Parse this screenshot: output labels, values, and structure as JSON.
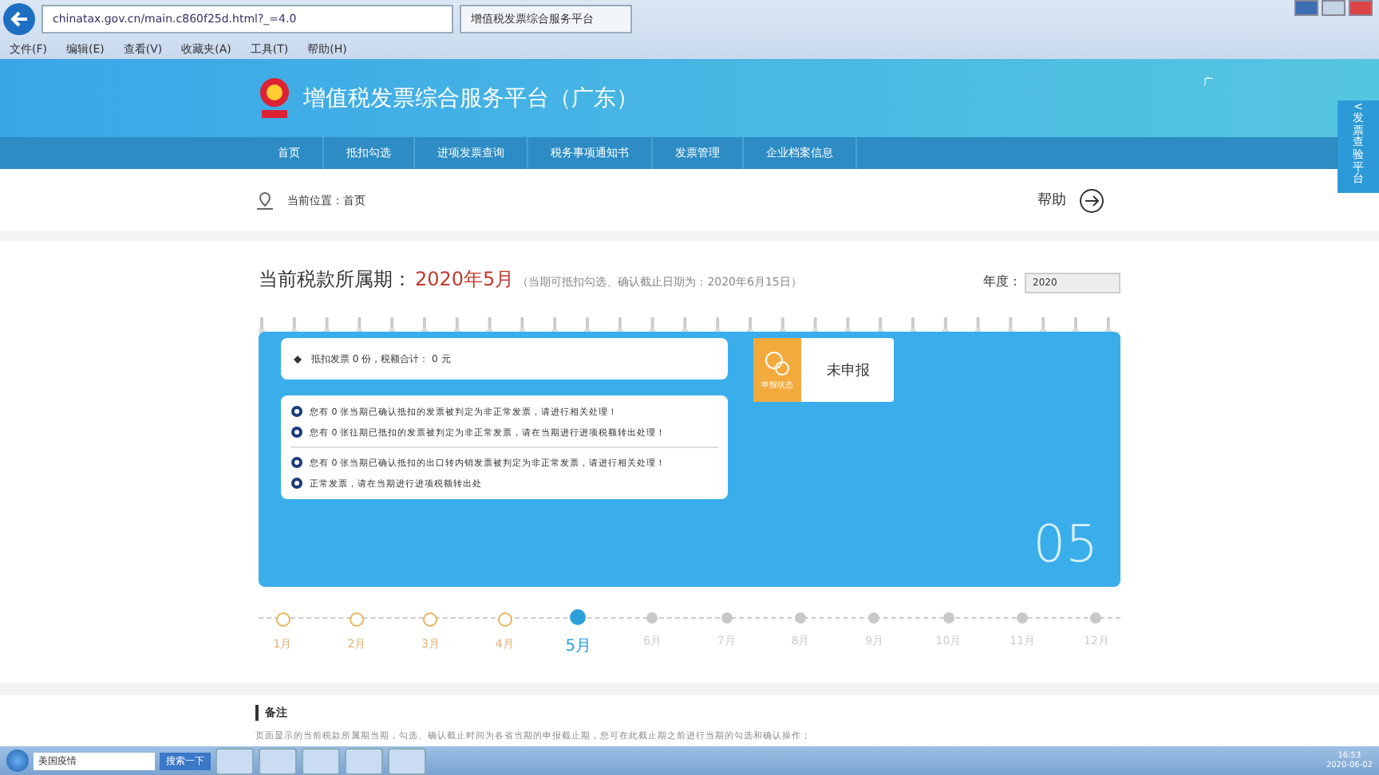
{
  "browser": {
    "url": "chinatax.gov.cn/main.c860f25d.html?_=4.0",
    "tab": "增值税发票综合服务平台",
    "menu": [
      "文件(F)",
      "编辑(E)",
      "查看(V)",
      "收藏夹(A)",
      "工具(T)",
      "帮助(H)"
    ]
  },
  "header": {
    "title": "增值税发票综合服务平台（广东）",
    "user": "广"
  },
  "nav": [
    {
      "label": "首页"
    },
    {
      "label": "抵扣勾选"
    },
    {
      "label": "进项发票查询"
    },
    {
      "label": "税务事项通知书"
    },
    {
      "label": "发票管理"
    },
    {
      "label": "企业档案信息"
    }
  ],
  "side_tab": {
    "arrow": "<",
    "label": "发票查验平台"
  },
  "breadcrumb": {
    "label": "当前位置：",
    "current": "首页"
  },
  "help": "帮助",
  "period": {
    "label": "当前税款所属期：",
    "value": "2020年5月",
    "note": "（当期可抵扣勾选、确认截止日期为：2020年6月15日）",
    "year_label": "年度：",
    "year": "2020"
  },
  "summary": "抵扣发票 0 份，税额合计： 0 元",
  "notices": [
    {
      "text": "您有 0 张当期已确认抵扣的发票被判定为非正常发票，请进行相关处理！",
      "divider": false
    },
    {
      "text": "您有 0 张往期已抵扣的发票被判定为非正常发票，请在当期进行进项税额转出处理！",
      "divider": false
    },
    {
      "text": "您有 0 张当期已确认抵扣的出口转内销发票被判定为非正常发票，请进行相关处理！",
      "divider": true
    },
    {
      "text": "正常发票，请在当期进行进项税额转出处",
      "divider": false
    }
  ],
  "status": {
    "label": "申报状态",
    "value": "未申报"
  },
  "big_month": "05",
  "months": [
    {
      "label": "1月",
      "passed": true,
      "selected": false
    },
    {
      "label": "2月",
      "passed": true,
      "selected": false
    },
    {
      "label": "3月",
      "passed": true,
      "selected": false
    },
    {
      "label": "4月",
      "passed": true,
      "selected": false
    },
    {
      "label": "5月",
      "passed": false,
      "selected": true
    },
    {
      "label": "6月",
      "passed": false,
      "selected": false
    },
    {
      "label": "7月",
      "passed": false,
      "selected": false
    },
    {
      "label": "8月",
      "passed": false,
      "selected": false
    },
    {
      "label": "9月",
      "passed": false,
      "selected": false
    },
    {
      "label": "10月",
      "passed": false,
      "selected": false
    },
    {
      "label": "11月",
      "passed": false,
      "selected": false
    },
    {
      "label": "12月",
      "passed": false,
      "selected": false
    }
  ],
  "remark": {
    "title": "备注",
    "text": "页面显示的当前税款所属期当期，勾选、确认截止时间为各省当期的申报截止期，您可在此截止期之前进行当期的勾选和确认操作；"
  },
  "taskbar": {
    "search": "美国疫情",
    "search_button": "搜索一下",
    "time": "16:53",
    "date": "2020-06-02"
  }
}
